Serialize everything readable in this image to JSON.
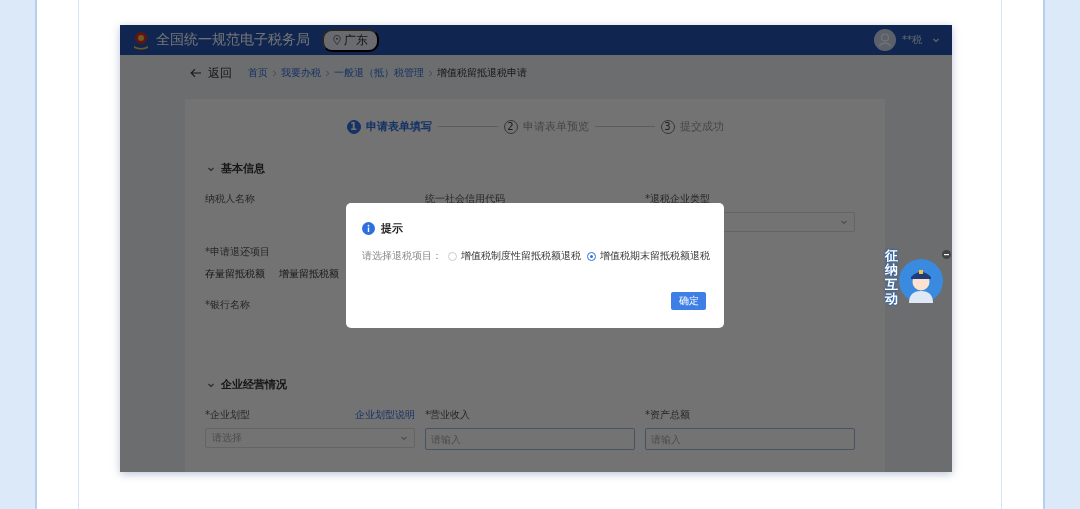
{
  "header": {
    "title": "全国统一规范电子税务局",
    "region": "广东",
    "user": "**税"
  },
  "breadcrumb": {
    "back": "返回",
    "items": [
      "首页",
      "我要办税",
      "一般退（抵）税管理",
      "增值税留抵退税申请"
    ]
  },
  "steps": [
    {
      "number": "1",
      "label": "申请表单填写",
      "selected": true
    },
    {
      "number": "2",
      "label": "申请表单预览",
      "selected": false
    },
    {
      "number": "3",
      "label": "提交成功",
      "selected": false
    }
  ],
  "sections": [
    {
      "title": "基本信息",
      "rows": [
        [
          {
            "kind": "text",
            "label": "纳税人名称"
          },
          {
            "kind": "text",
            "label": "统一社会信用代码"
          },
          {
            "kind": "select",
            "label": "*退税企业类型"
          }
        ],
        [
          {
            "kind": "options",
            "label": "*申请退还项目",
            "options": [
              "存量留抵税额",
              "增量留抵税额"
            ]
          }
        ],
        [
          {
            "kind": "text",
            "label": "*银行名称"
          }
        ]
      ]
    },
    {
      "title": "企业经营情况",
      "rows": [
        [
          {
            "kind": "select",
            "label": "*企业划型",
            "link": "企业划型说明",
            "placeholder": "请选择"
          },
          {
            "kind": "input",
            "label": "*营业收入",
            "placeholder": "请输入"
          },
          {
            "kind": "input",
            "label": "*资产总额",
            "placeholder": "请输入"
          }
        ]
      ]
    }
  ],
  "dialog": {
    "title": "提示",
    "prompt": "请选择退税项目：",
    "options": [
      {
        "label": "增值税制度性留抵税额退税",
        "selected": false
      },
      {
        "label": "增值税期末留抵税额退税",
        "selected": true
      }
    ],
    "button": "确定"
  },
  "assistant": {
    "text": "征纳互动"
  }
}
